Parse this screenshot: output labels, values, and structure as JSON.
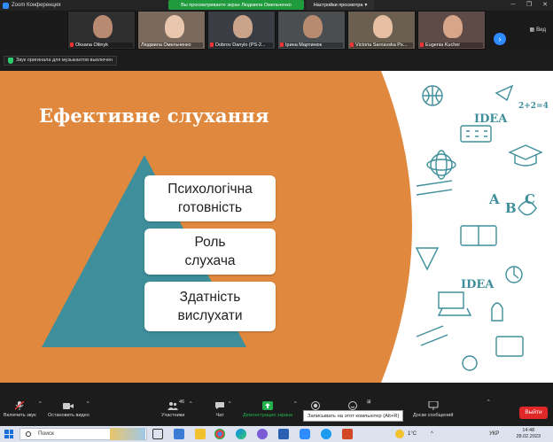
{
  "window": {
    "title": "Zoom Конференция",
    "share_banner": "Вы просматриваете экран Людмила Омельченко",
    "view_options": "Настройки просмотра",
    "view_label": "Вид"
  },
  "participants": [
    {
      "name": "Oksana Oliinyk",
      "muted": true
    },
    {
      "name": "Людмила Омельченко",
      "muted": false
    },
    {
      "name": "Dobrov Danylo (PS-2...",
      "muted": true
    },
    {
      "name": "Ірина Мартинюк",
      "muted": true
    },
    {
      "name": "Victoria Sarnavska Ps...",
      "muted": true
    },
    {
      "name": "Eugenia Kucher",
      "muted": true
    }
  ],
  "notice": "Звук оригинала для музыкантов выключен",
  "slide": {
    "title": "Ефективне слухання",
    "levels": [
      "Психологічна готовність",
      "Роль слухача",
      "Здатність вислухати"
    ],
    "doodle_words": [
      "IDEA",
      "IDEA",
      "A",
      "B",
      "C",
      "2+2=4"
    ],
    "colors": {
      "background": "#e0893e",
      "pyramid": "#3e8f9b",
      "doodle": "#3e8f9b"
    }
  },
  "toolbar": {
    "unmute": "Включить звук",
    "video": "Остановить видео",
    "participants": "Участники",
    "participants_count": "46",
    "chat": "Чат",
    "share": "Демонстрация экрана",
    "record": "Записывать на этот компьютер (Alt+R)",
    "whiteboard": "Доски сообщений",
    "leave": "Выйти"
  },
  "taskbar": {
    "search": "Поиск",
    "temperature": "1°C",
    "language": "УКР",
    "time": "14:48",
    "date": "28.02.2023"
  }
}
